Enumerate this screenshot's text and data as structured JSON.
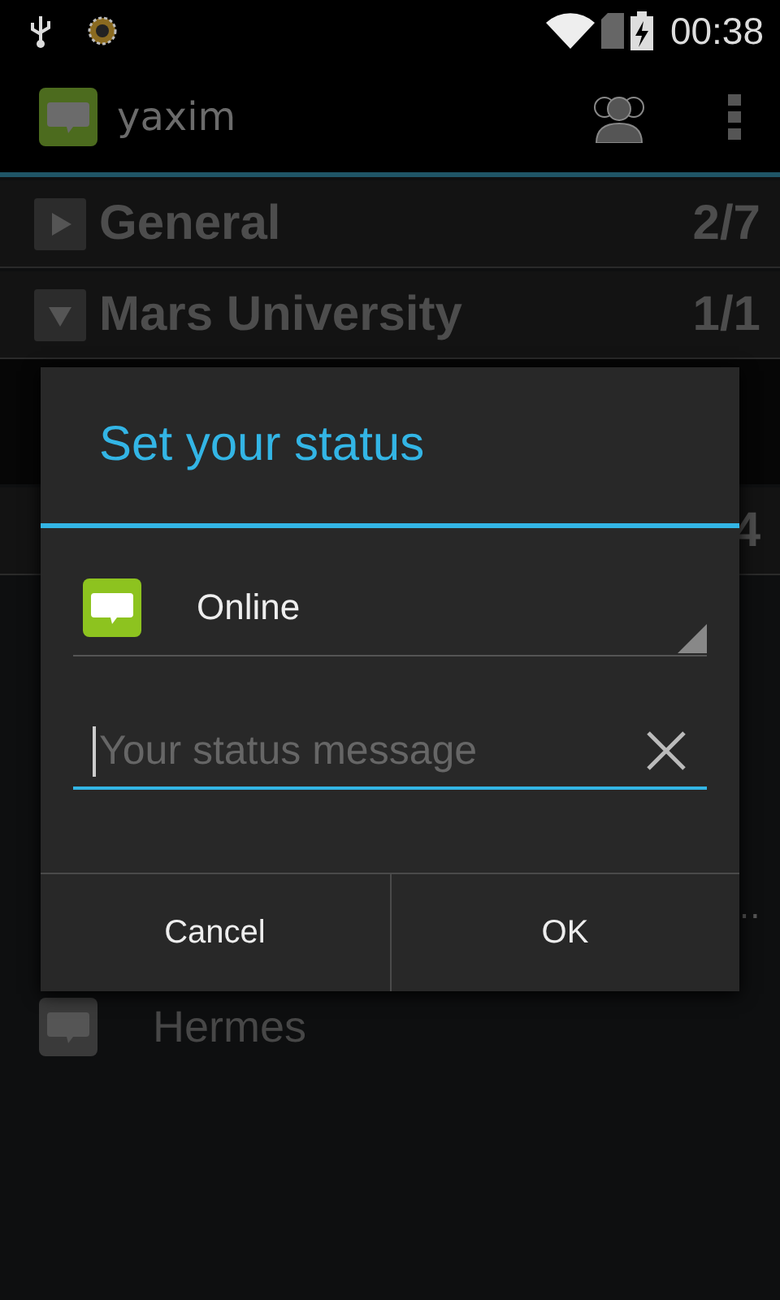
{
  "status_bar": {
    "time": "00:38"
  },
  "action_bar": {
    "title": "yaxim"
  },
  "groups": [
    {
      "name": "General",
      "count": "2/7",
      "expanded": false
    },
    {
      "name": "Mars University",
      "count": "1/1",
      "expanded": true
    }
  ],
  "covered_group": {
    "count": "4"
  },
  "covered_contact": {
    "status": "…"
  },
  "contacts": [
    {
      "name": "Hermes"
    }
  ],
  "dialog": {
    "title": "Set your status",
    "status": {
      "label": "Online"
    },
    "message": {
      "placeholder": "Your status message"
    },
    "buttons": [
      "Cancel",
      "OK"
    ]
  }
}
